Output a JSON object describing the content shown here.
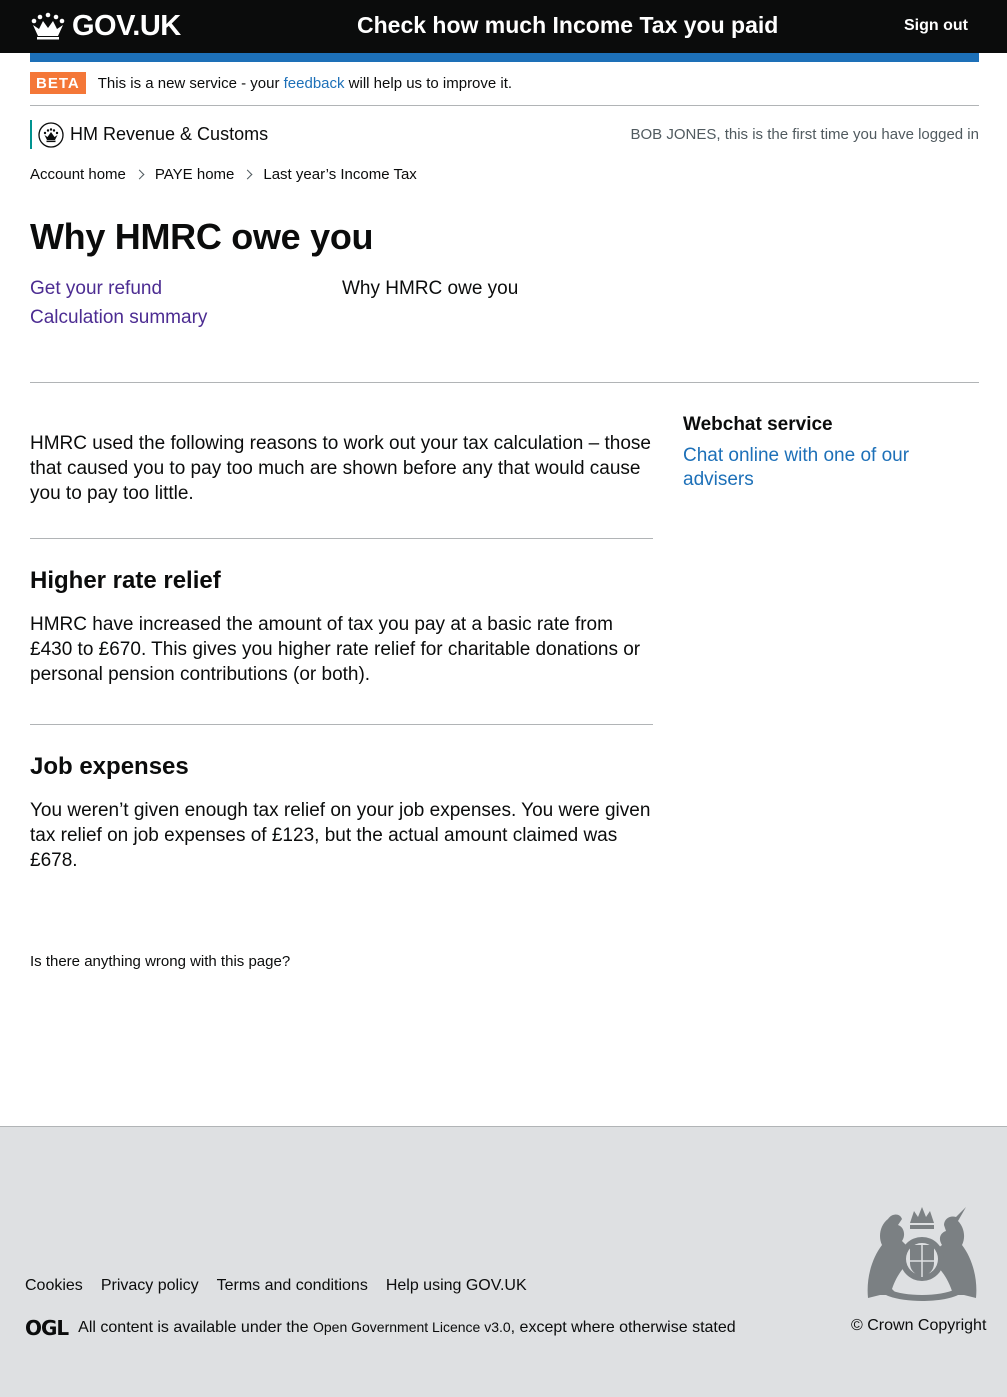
{
  "header": {
    "logo_text": "GOV.UK",
    "service_name": "Check how much Income Tax you paid",
    "sign_out": "Sign out"
  },
  "phase_banner": {
    "tag": "BETA",
    "text_before": "This is a new service - your ",
    "link": "feedback",
    "text_after": " will help us to improve it."
  },
  "department": {
    "name": "HM Revenue & Customs",
    "login_note": "BOB JONES, this is the first time you have logged in"
  },
  "breadcrumbs": [
    "Account home",
    "PAYE home",
    "Last year’s Income Tax"
  ],
  "page_title": "Why HMRC owe you",
  "subnav": {
    "links": [
      "Get your refund",
      "Calculation summary"
    ],
    "current": "Why HMRC owe you"
  },
  "intro": "HMRC used the following reasons to work out your tax calculation – those that caused you to pay too much are shown before any that would cause you to pay too little.",
  "sections": [
    {
      "heading": "Higher rate relief",
      "body": "HMRC have increased the amount of tax you pay at a basic rate from £430 to £670. This gives you higher rate relief for charitable donations or personal pension contributions (or both)."
    },
    {
      "heading": "Job expenses",
      "body": "You weren’t given enough tax relief on your job expenses. You were given tax relief on job expenses of £123, but the actual amount claimed was £678."
    }
  ],
  "sidebar": {
    "heading": "Webchat service",
    "link": "Chat online with one of our advisers"
  },
  "report_link": "Is there anything wrong with this page?",
  "footer": {
    "links": [
      "Cookies",
      "Privacy policy",
      "Terms and conditions",
      "Help using GOV.UK"
    ],
    "ogl_logo": "OGL",
    "licence_before": "All content is available under the ",
    "licence_link": "Open Government Licence v3.0",
    "licence_after": ", except where otherwise stated",
    "copyright": "© Crown Copyright"
  },
  "colors": {
    "header_bg": "#0b0c0c",
    "blue_bar": "#1d70b8",
    "beta_tag": "#f47738",
    "hmrc_stripe": "#009390",
    "visited_link": "#4c2c92",
    "footer_bg": "#dee0e2"
  }
}
